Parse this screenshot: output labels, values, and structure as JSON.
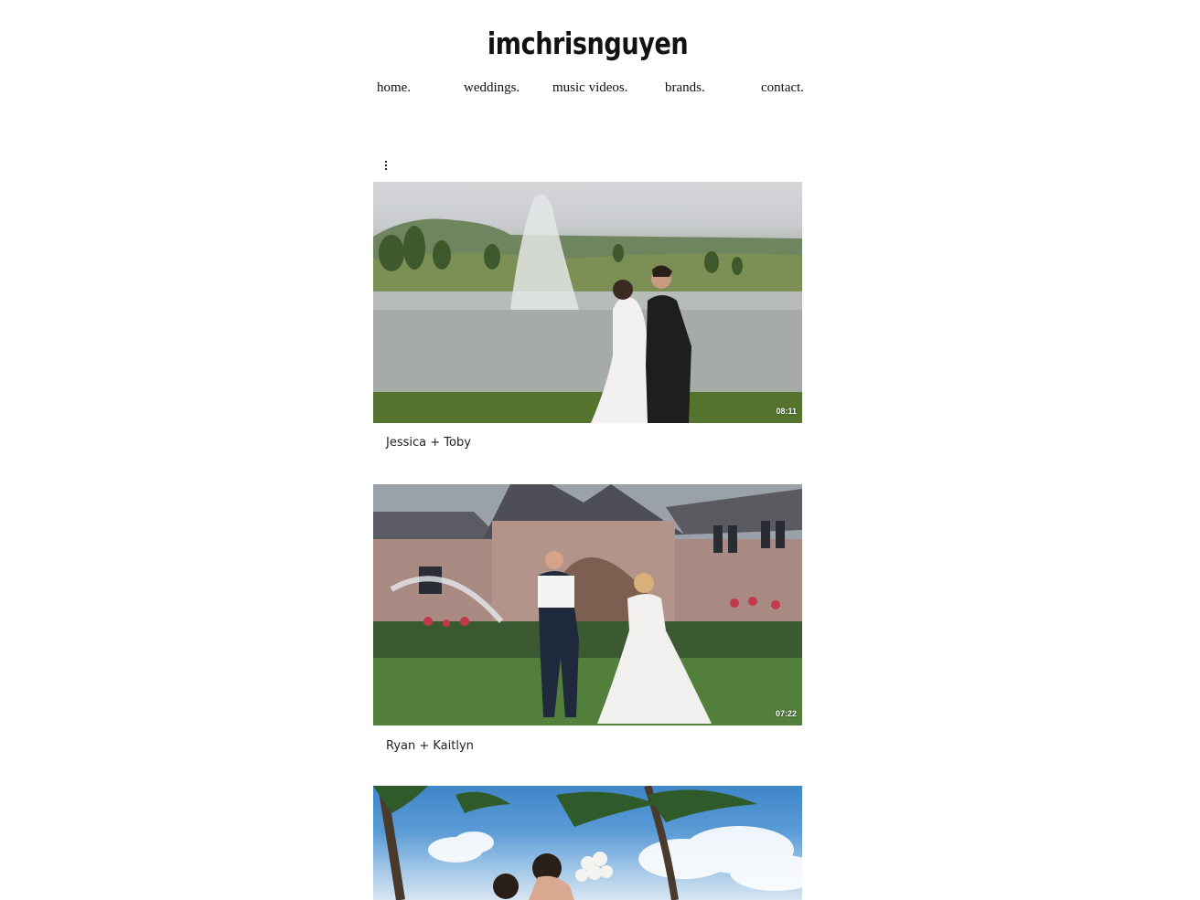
{
  "site": {
    "title": "imchrisnguyen"
  },
  "nav": {
    "items": [
      {
        "label": "home."
      },
      {
        "label": "weddings."
      },
      {
        "label": "music videos."
      },
      {
        "label": "brands."
      },
      {
        "label": "contact."
      }
    ]
  },
  "menu": {
    "icon": "more-vertical-icon"
  },
  "videos": [
    {
      "title": "Jessica + Toby",
      "duration": "08:11"
    },
    {
      "title": "Ryan + Kaitlyn",
      "duration": "07:22"
    },
    {
      "title": "",
      "duration": ""
    }
  ]
}
